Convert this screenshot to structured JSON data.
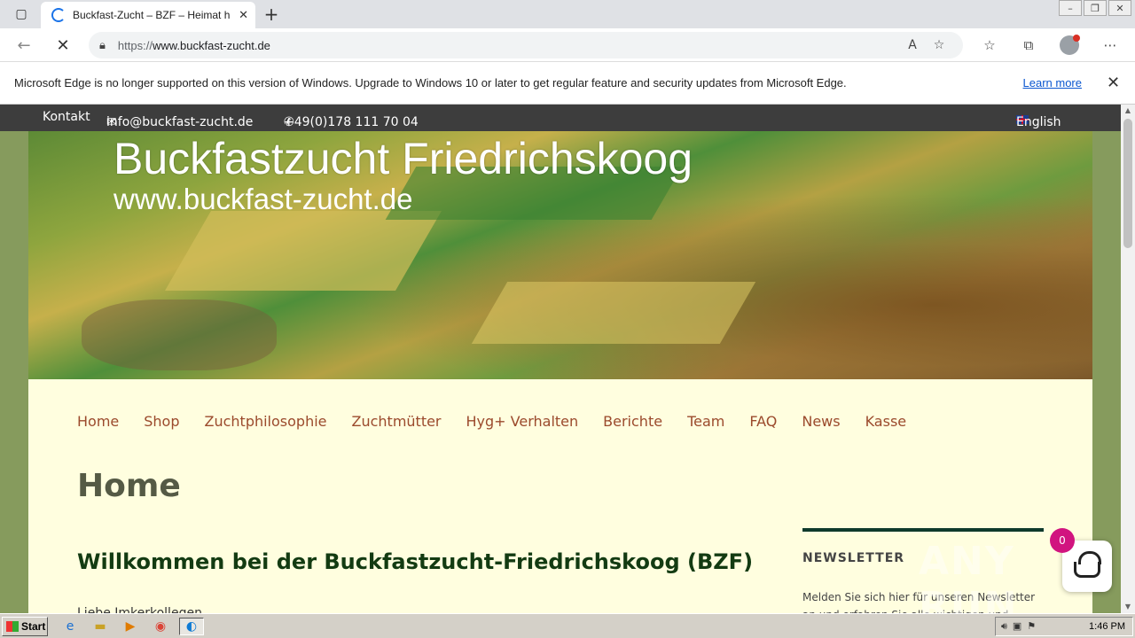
{
  "browser": {
    "tab_title": "Buckfast-Zucht – BZF – Heimat h",
    "url_scheme": "https://",
    "url_host": "www.buckfast-zucht.de",
    "icons": [
      "tab-actions-icon",
      "loading-icon",
      "close-icon",
      "plus-icon",
      "back-icon",
      "stop-icon",
      "lock-icon",
      "read-aloud-icon",
      "add-favorite-icon",
      "favorites-icon",
      "collections-icon",
      "profile-icon",
      "more-icon"
    ]
  },
  "infobar": {
    "message": "Microsoft Edge is no longer supported on this version of Windows. Upgrade to Windows 10 or later to get regular feature and security updates from Microsoft Edge.",
    "link": "Learn more"
  },
  "topbar": {
    "contact": "Kontakt",
    "email": "info@buckfast-zucht.de",
    "phone": "+49(0)178 111 70 04",
    "language": "English"
  },
  "header": {
    "title": "Buckfastzucht Friedrichskoog",
    "subtitle": "www.buckfast-zucht.de"
  },
  "menu": [
    "Home",
    "Shop",
    "Zuchtphilosophie",
    "Zuchtmütter",
    "Hyg+ Verhalten",
    "Berichte",
    "Team",
    "FAQ",
    "News",
    "Kasse"
  ],
  "main": {
    "page_title": "Home",
    "welcome": "Willkommen bei der Buckfastzucht-Friedrichskoog (BZF)",
    "intro": "Liebe Imkerkollegen,"
  },
  "sidebar": {
    "widget_title": "NEWSLETTER",
    "widget_text": "Melden Sie sich hier für unseren Newsletter an und erfahren Sie alle wichtigen und"
  },
  "cart": {
    "count": "0"
  },
  "watermark": "ANY RUN",
  "taskbar": {
    "start": "Start",
    "clock": "1:46 PM"
  },
  "colors": {
    "page_bg": "#869b5d",
    "content_bg": "#fffedf",
    "menu_link": "#9b4a2c",
    "heading": "#133b12",
    "topbar": "#3d3d3d",
    "cart_badge": "#d1147f"
  }
}
